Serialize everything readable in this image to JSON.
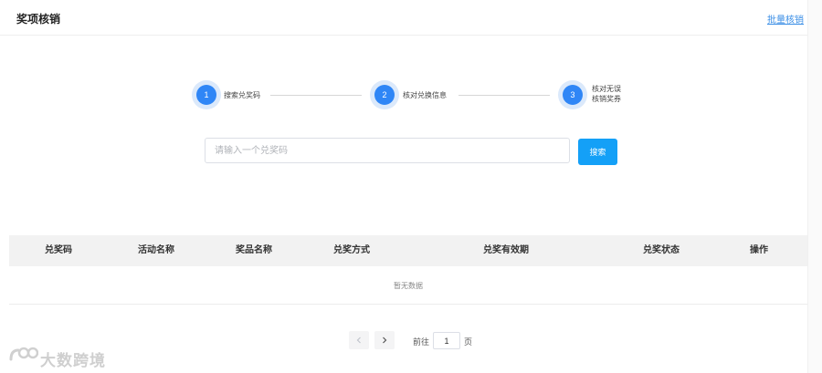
{
  "header": {
    "title": "奖项核销",
    "batch_link": "批量核销"
  },
  "steps": [
    {
      "number": "1",
      "label": "搜索兑奖码"
    },
    {
      "number": "2",
      "label": "核对兑换信息"
    },
    {
      "number": "3",
      "label_line1": "核对无误",
      "label_line2": "核销奖券"
    }
  ],
  "search": {
    "placeholder": "请输入一个兑奖码",
    "value": "",
    "button_label": "搜索"
  },
  "table": {
    "columns": [
      "兑奖码",
      "活动名称",
      "奖品名称",
      "兑奖方式",
      "兑奖有效期",
      "兑奖状态",
      "操作"
    ],
    "rows": [],
    "empty_text": "暂无数据"
  },
  "pagination": {
    "goto_prefix": "前往",
    "current_page": "1",
    "goto_suffix": "页"
  },
  "watermark": {
    "text": "大数跨境"
  },
  "colors": {
    "primary": "#2f86f6",
    "button": "#14a0f7",
    "link": "#3a8ee6"
  }
}
